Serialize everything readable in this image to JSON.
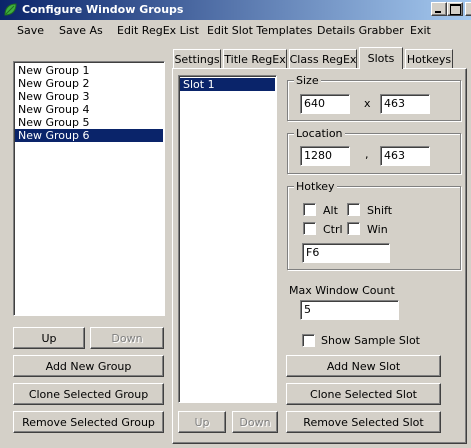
{
  "window": {
    "title": "Configure Window Groups",
    "icon": "leaf-icon"
  },
  "menu": [
    "Save",
    "Save As",
    "Edit RegEx List",
    "Edit Slot Templates",
    "Details Grabber",
    "Exit"
  ],
  "groups": {
    "items": [
      "New Group 1",
      "New Group 2",
      "New Group 3",
      "New Group 4",
      "New Group 5",
      "New Group 6"
    ],
    "selected": "New Group 6",
    "up_label": "Up",
    "down_label": "Down",
    "add_label": "Add New Group",
    "clone_label": "Clone Selected Group",
    "remove_label": "Remove Selected Group"
  },
  "tabs": [
    "Settings",
    "Title RegEx",
    "Class RegEx",
    "Slots",
    "Hotkeys"
  ],
  "active_tab": "Slots",
  "slots": {
    "items": [
      "Slot 1"
    ],
    "selected": "Slot 1",
    "up_label": "Up",
    "down_label": "Down",
    "add_label": "Add New Slot",
    "clone_label": "Clone Selected Slot",
    "remove_label": "Remove Selected Slot"
  },
  "size": {
    "label": "Size",
    "width": "640",
    "separator": "x",
    "height": "463"
  },
  "location": {
    "label": "Location",
    "x": "1280",
    "separator": ",",
    "y": "463"
  },
  "hotkey": {
    "label": "Hotkey",
    "alt_label": "Alt",
    "alt_checked": false,
    "shift_label": "Shift",
    "shift_checked": false,
    "ctrl_label": "Ctrl",
    "ctrl_checked": false,
    "win_label": "Win",
    "win_checked": false,
    "key": "F6"
  },
  "max_window_count": {
    "label": "Max Window Count",
    "value": "5"
  },
  "show_sample_slot": {
    "label": "Show Sample Slot",
    "checked": false
  },
  "colors": {
    "selection": "#0a246a",
    "face": "#d4d0c8"
  }
}
